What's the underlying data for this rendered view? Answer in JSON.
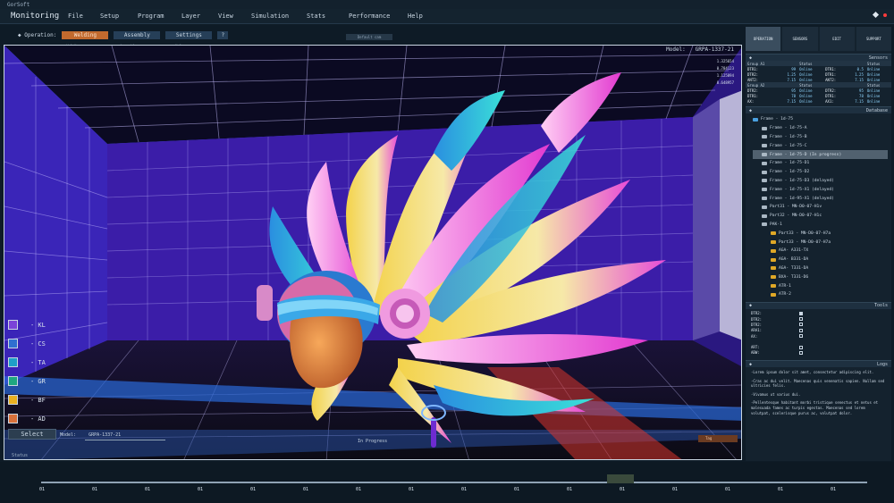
{
  "titlebar": {
    "text": "GorSoft"
  },
  "menubar": {
    "app_name": "Monitoring",
    "items": [
      "File",
      "Setup",
      "Program",
      "Layer",
      "View",
      "Simulation",
      "Stats",
      "Performance",
      "Help"
    ]
  },
  "operation": {
    "label": "Operation:",
    "buttons": [
      "Welding",
      "Assembly",
      "Settings",
      "?"
    ],
    "active": "Welding",
    "default_button": "Default cam",
    "sublabels": [
      "Welding",
      "Assembl",
      "Help"
    ]
  },
  "viewport": {
    "model_label": "Model:",
    "model_value": "GRPA-1337-21",
    "readouts": [
      "1.325654",
      "0.784123",
      "1.125894",
      "0.648957"
    ],
    "status_text": "In Progress",
    "status_label": "Status",
    "select_button": "Select",
    "model_field_label": "Model:",
    "model_field_value": "GRPA-1337-21",
    "tag": "Tag"
  },
  "legend": [
    {
      "label": "- KL",
      "color": "#7a43d8"
    },
    {
      "label": "- CS",
      "color": "#2f6fd0"
    },
    {
      "label": "- TA",
      "color": "#1fa0c8"
    },
    {
      "label": "- GR",
      "color": "#1fa880"
    },
    {
      "label": "- BF",
      "color": "#e8b020"
    },
    {
      "label": "- AD",
      "color": "#d8703a"
    }
  ],
  "panel": {
    "tabs": [
      "OPERATION",
      "SENSORS",
      "EDIT",
      "SUPPORT"
    ],
    "active_tab": "OPERATION",
    "sensors": {
      "title": "Sensors",
      "group1": {
        "headers": [
          "Group A1",
          "Status",
          "",
          "Status"
        ],
        "rows": [
          [
            "DTR1:",
            "99",
            "Online",
            "DTR1:",
            "0.5",
            "Online"
          ],
          [
            "DTR2:",
            "1.25",
            "Online",
            "DTR1:",
            "1.25",
            "Online"
          ],
          [
            "ANT2:",
            "7.15",
            "Online",
            "ANT2:",
            "7.15",
            "Online"
          ]
        ]
      },
      "group2": {
        "headers": [
          "Group A2",
          "Status",
          "",
          "Status"
        ],
        "rows": [
          [
            "DTR2:",
            "95",
            "Online",
            "DTR2:",
            "95",
            "Online"
          ],
          [
            "DTR1:",
            "78",
            "Online",
            "DTR1:",
            "78",
            "Online"
          ],
          [
            "AX:",
            "7.15",
            "Online",
            "AX1:",
            "7.15",
            "Online"
          ]
        ]
      }
    },
    "database": {
      "title": "Database",
      "items": [
        {
          "label": "Frame - 1d-75",
          "color": "blue",
          "indent": 0
        },
        {
          "label": "Frame - 1d-75-A",
          "color": "grey",
          "indent": 1
        },
        {
          "label": "Frame - 1d-75-B",
          "color": "grey",
          "indent": 1
        },
        {
          "label": "Frame - 1d-75-C",
          "color": "grey",
          "indent": 1
        },
        {
          "label": "Frame - 1d-75-D (In progress)",
          "color": "grey",
          "indent": 1,
          "selected": true
        },
        {
          "label": "Frame - 1d-75-D1",
          "color": "grey",
          "indent": 1
        },
        {
          "label": "Frame - 1d-75-D2",
          "color": "grey",
          "indent": 1
        },
        {
          "label": "Frame - 1d-75-D3 (delayed)",
          "color": "grey",
          "indent": 1
        },
        {
          "label": "Frame - 1d-75-X1 (delayed)",
          "color": "grey",
          "indent": 1
        },
        {
          "label": "Frame - 1d-95-X1 (delayed)",
          "color": "grey",
          "indent": 1
        },
        {
          "label": "Part31 - MN-D0-07-H1v",
          "color": "grey",
          "indent": 1
        },
        {
          "label": "Part32 - MN-D0-07-H1c",
          "color": "grey",
          "indent": 1
        },
        {
          "label": "PAK-1",
          "color": "grey",
          "indent": 1
        },
        {
          "label": "Part33 - MN-D0-07-H7a",
          "color": "yellow",
          "indent": 2
        },
        {
          "label": "Part33 - MN-D0-07-H7a",
          "color": "yellow",
          "indent": 2
        },
        {
          "label": "AGA- A331-TX",
          "color": "yellow",
          "indent": 2
        },
        {
          "label": "AGA- B331-DA",
          "color": "yellow",
          "indent": 2
        },
        {
          "label": "AGA- T331-DA",
          "color": "yellow",
          "indent": 2
        },
        {
          "label": "BXA- T331-D6",
          "color": "yellow",
          "indent": 2
        },
        {
          "label": "ATR-1",
          "color": "yellow",
          "indent": 2
        },
        {
          "label": "ATR-2",
          "color": "yellow",
          "indent": 2
        }
      ]
    },
    "tools": {
      "title": "Tools",
      "rows": [
        {
          "label": "DTR2:",
          "checked": true
        },
        {
          "label": "DTR2:",
          "checked": false
        },
        {
          "label": "DTR2:",
          "checked": false
        },
        {
          "label": "ARA1:",
          "checked": false
        },
        {
          "label": "AX:",
          "checked": false
        },
        {
          "label": "",
          "checked": false
        },
        {
          "label": "ART:",
          "checked": false
        },
        {
          "label": "ABW:",
          "checked": false
        }
      ]
    },
    "logs": {
      "title": "Logs",
      "entries": [
        "-Lorem ipsum dolor sit amet, consectetur adipiscing elit.",
        "-Cras ac dui velit. Maecenas quis venenatis sapien. Nullam sed ultricies felis.",
        "-Vivamus ut varius dui.",
        "-Pellentesque habitant morbi tristique senectus et netus et malesuada fames ac turpis egestas. Maecenas sed lorem volutpat, scelerisque purus ac, volutpat dolor."
      ]
    }
  },
  "timeline": {
    "ticks": [
      "01",
      "01",
      "01",
      "01",
      "01",
      "01",
      "01",
      "01",
      "01",
      "01",
      "01",
      "01",
      "01",
      "01",
      "01",
      "01"
    ]
  }
}
